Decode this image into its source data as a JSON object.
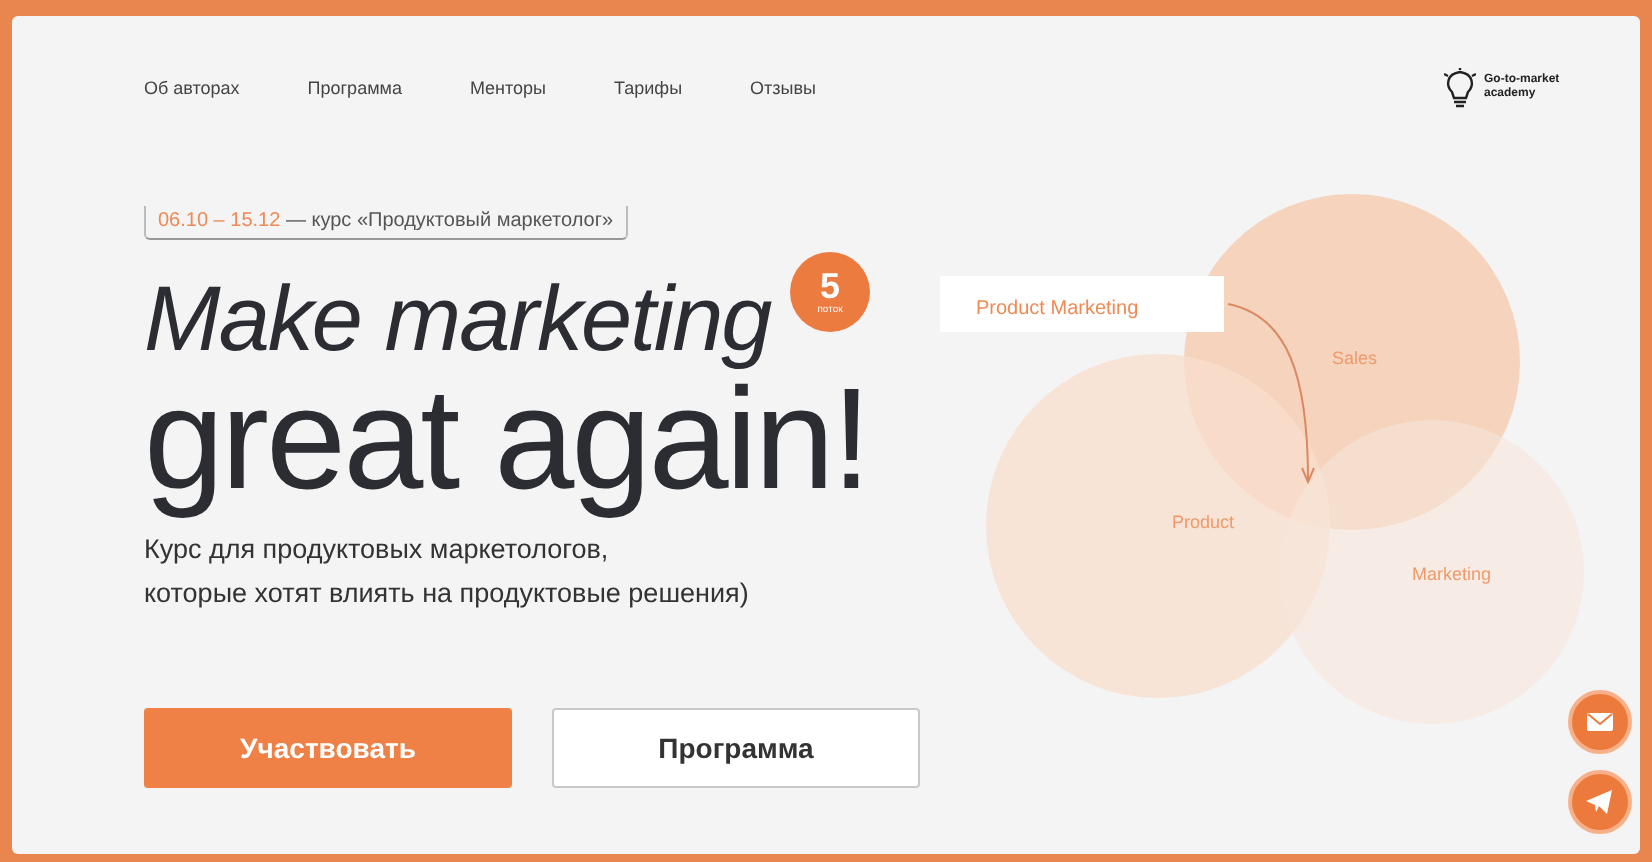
{
  "nav": {
    "items": [
      {
        "label": "Об авторах"
      },
      {
        "label": "Программа"
      },
      {
        "label": "Менторы"
      },
      {
        "label": "Тарифы"
      },
      {
        "label": "Отзывы"
      }
    ],
    "logo": {
      "text": "Go-to-market academy"
    }
  },
  "hero": {
    "dates": "06.10 – 15.12",
    "course": "— курс «Продуктовый маркетолог»",
    "title_line1": "Make marketing",
    "title_line2": "great again!",
    "badge": {
      "number": "5",
      "caption": "поток"
    },
    "subtitle": "Курс для продуктовых маркетологов,\nкоторые хотят влиять на продуктовые решения)",
    "buttons": [
      {
        "label": "Участвовать",
        "kind": "primary"
      },
      {
        "label": "Программа",
        "kind": "secondary"
      }
    ]
  },
  "diagram": {
    "callout": "Product Marketing",
    "circles": [
      {
        "label": "Sales"
      },
      {
        "label": "Product"
      },
      {
        "label": "Marketing"
      }
    ]
  },
  "side_buttons": [
    {
      "kind": "mail"
    },
    {
      "kind": "telegram"
    }
  ]
}
